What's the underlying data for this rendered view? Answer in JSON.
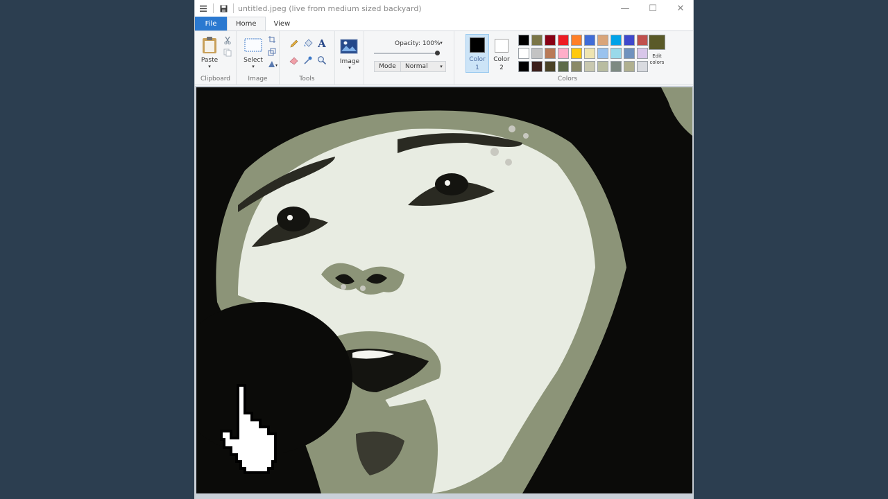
{
  "window": {
    "title": "untitled.jpeg (live from medium sized backyard)"
  },
  "titlebar": {
    "menu_icon": "hamburger-icon",
    "save_icon": "save-icon",
    "minimize_glyph": "—",
    "maximize_glyph": "☐",
    "close_glyph": "✕"
  },
  "tabs": {
    "file": "File",
    "home": "Home",
    "view": "View"
  },
  "ribbon": {
    "clipboard": {
      "paste_label": "Paste",
      "group_label": "Clipboard"
    },
    "image": {
      "select_label": "Select",
      "group_label": "Image"
    },
    "tools": {
      "group_label": "Tools"
    },
    "shapes": {
      "image_label": "Image"
    },
    "opacity": {
      "label": "Opacity: 100%",
      "value_percent": 100
    },
    "mode": {
      "label": "Mode",
      "value": "Normal"
    },
    "colors": {
      "color1_label_a": "Color",
      "color1_label_b": "1",
      "color2_label_a": "Color",
      "color2_label_b": "2",
      "color1_value": "#000000",
      "color2_value": "#ffffff",
      "edit_label_a": "Edit",
      "edit_label_b": "colors",
      "edit_color": "#5a5a28",
      "group_label": "Colors",
      "palette_row1": [
        "#000000",
        "#7a7547",
        "#880015",
        "#ed1c24",
        "#ff7f27",
        "#3f6cd8",
        "#d9a57a",
        "#00a2e8",
        "#3f48cc",
        "#c0504d"
      ],
      "palette_row2": [
        "#ffffff",
        "#c3c3c3",
        "#b97a57",
        "#ffaec9",
        "#ffc90e",
        "#efe4b0",
        "#99c2ee",
        "#99d9ea",
        "#7092be",
        "#d8c6ea"
      ],
      "palette_row3": [
        "#000000",
        "#3b1f1a",
        "#4a4226",
        "#5d6b4a",
        "#8a8a68",
        "#c8c8b0",
        "#b8bca0",
        "#7e8a82",
        "#b0b090",
        "#d9dbe0"
      ]
    }
  },
  "canvas": {
    "image_desc": "posterized-face-image",
    "duotone_light": "#e8ece2",
    "duotone_mid": "#8c9478",
    "duotone_dark": "#0b0b09"
  }
}
